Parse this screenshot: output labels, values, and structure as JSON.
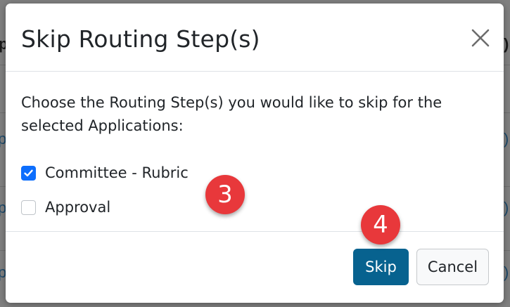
{
  "background": {
    "fragments": [
      "p",
      "p",
      "p",
      "p",
      ")",
      "),",
      ")",
      "),",
      ")",
      ")"
    ]
  },
  "modal": {
    "title": "Skip Routing Step(s)",
    "close_icon": "close-icon",
    "instruction": "Choose the Routing Step(s) you would like to skip for the selected Applications:",
    "steps": [
      {
        "label": "Committee - Rubric",
        "checked": true
      },
      {
        "label": "Approval",
        "checked": false
      }
    ],
    "footer": {
      "skip_label": "Skip",
      "cancel_label": "Cancel"
    }
  },
  "annotations": {
    "badge_3": "3",
    "badge_4": "4"
  },
  "colors": {
    "primary_checkbox": "#0d6efd",
    "skip_button": "#07628f",
    "badge": "#e8383b"
  }
}
